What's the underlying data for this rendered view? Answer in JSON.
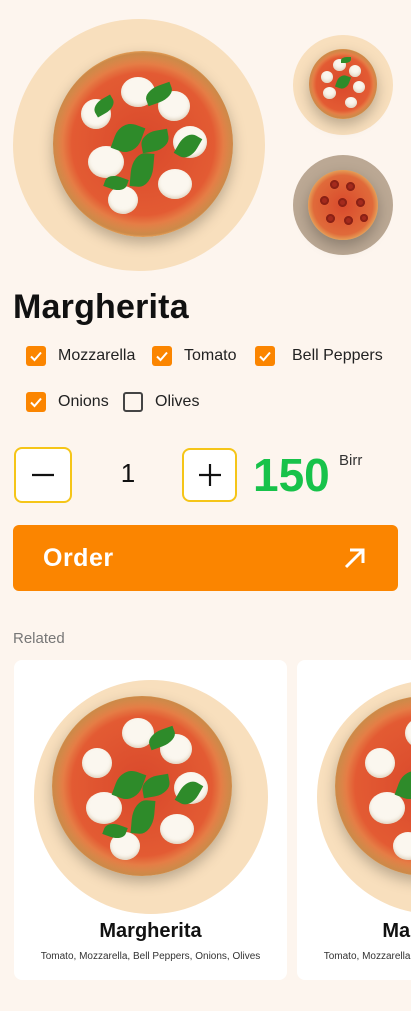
{
  "product": {
    "name": "Margherita",
    "toppings": [
      {
        "label": "Mozzarella",
        "checked": true
      },
      {
        "label": "Tomato",
        "checked": true
      },
      {
        "label": "Bell Peppers",
        "checked": true
      },
      {
        "label": "Onions",
        "checked": true
      },
      {
        "label": "Olives",
        "checked": false
      }
    ],
    "quantity": "1",
    "price": "150",
    "currency": "Birr"
  },
  "gallery": {
    "thumbnails": [
      "margherita-pizza",
      "pepperoni-pizza"
    ]
  },
  "actions": {
    "order_label": "Order"
  },
  "related": {
    "heading": "Related",
    "items": [
      {
        "name": "Margherita",
        "description": "Tomato, Mozzarella, Bell Peppers, Onions, Olives"
      },
      {
        "name": "Margherita",
        "description": "Tomato, Mozzarella, Bell Peppers, Onions, Olives"
      }
    ]
  },
  "colors": {
    "background": "#fdf5ee",
    "accent": "#fb8500",
    "price": "#17c24a",
    "stepper_border": "#f5c518",
    "plate": "#f8dfbd"
  },
  "icons": {
    "decrement": "minus-icon",
    "increment": "plus-icon",
    "order": "arrow-up-right-icon",
    "check": "check-icon"
  }
}
